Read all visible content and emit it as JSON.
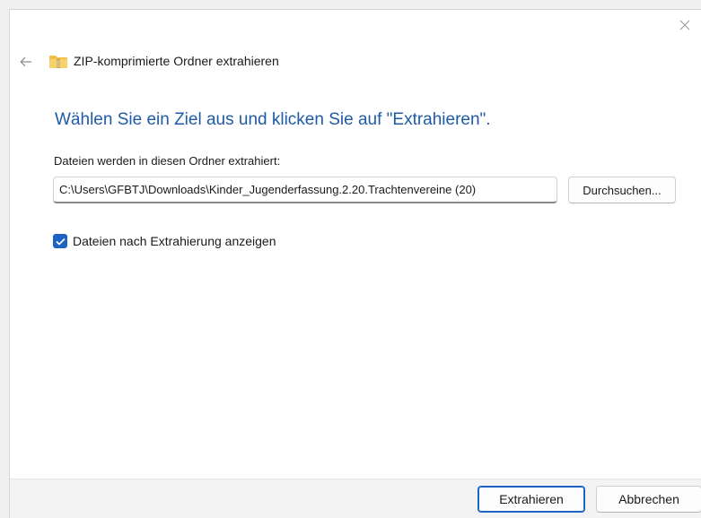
{
  "dialog": {
    "title": "ZIP-komprimierte Ordner extrahieren",
    "heading": "Wählen Sie ein Ziel aus und klicken Sie auf \"Extrahieren\".",
    "path_label": "Dateien werden in diesen Ordner extrahiert:",
    "path_value": "C:\\Users\\GFBTJ\\Downloads\\Kinder_Jugenderfassung.2.20.Trachtenvereine (20)",
    "browse_label": "Durchsuchen...",
    "show_after_label": "Dateien nach Extrahierung anzeigen",
    "show_after_checked": true,
    "extract_label": "Extrahieren",
    "cancel_label": "Abbrechen"
  },
  "icons": {
    "back": "back-arrow-icon",
    "folder": "zip-folder-icon",
    "close": "close-icon",
    "check": "checkmark-icon"
  },
  "colors": {
    "accent": "#1d63c4",
    "heading": "#1f5aa8",
    "footer_bg": "#f3f3f3",
    "folder_yellow": "#f4c542"
  }
}
